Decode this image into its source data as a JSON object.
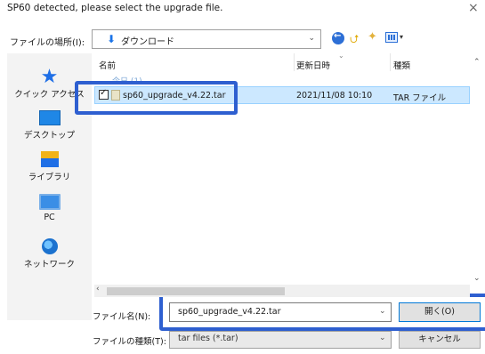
{
  "window": {
    "title": "SP60 detected, please select the upgrade file.",
    "close_glyph": "×"
  },
  "location": {
    "label": "ファイルの場所(I):",
    "value": "ダウンロード",
    "icon": "download-arrow-icon"
  },
  "toolbar": {
    "icons": [
      "back-icon",
      "up-folder-icon",
      "new-folder-icon",
      "view-menu-icon"
    ]
  },
  "sidebar": {
    "items": [
      {
        "label": "クイック アクセス",
        "icon": "star-icon"
      },
      {
        "label": "デスクトップ",
        "icon": "desktop-icon"
      },
      {
        "label": "ライブラリ",
        "icon": "library-icon"
      },
      {
        "label": "PC",
        "icon": "pc-icon"
      },
      {
        "label": "ネットワーク",
        "icon": "network-icon"
      }
    ]
  },
  "file_list": {
    "columns": [
      "名前",
      "更新日時",
      "種類"
    ],
    "group_label": "今日 (1)",
    "rows": [
      {
        "name": "sp60_upgrade_v4.22.tar",
        "modified": "2021/11/08 10:10",
        "type": "TAR ファイル",
        "checked": true,
        "selected": true
      }
    ]
  },
  "bottom": {
    "filename_label": "ファイル名(N):",
    "filename_value": "sp60_upgrade_v4.22.tar",
    "filetype_label": "ファイルの種類(T):",
    "filetype_value": "tar files (*.tar)",
    "open_label": "開く(O)",
    "cancel_label": "キャンセル"
  },
  "colors": {
    "highlight": "#2e5fd0",
    "selection": "#cce8ff"
  }
}
